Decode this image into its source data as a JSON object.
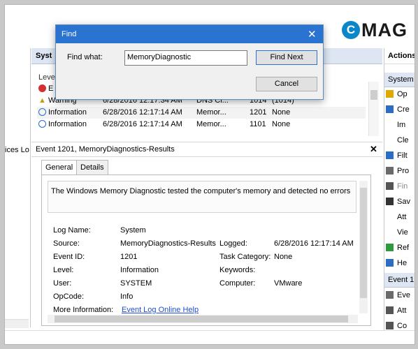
{
  "brand": {
    "letter": "C",
    "text": "MAG"
  },
  "left_pane": {
    "truncated_text": "ices Lo"
  },
  "event_list": {
    "header_title": "Syst",
    "column_header": "Leve",
    "rows": [
      {
        "level": "E",
        "date": "",
        "source": "",
        "event_id": "",
        "category": "",
        "icon": "error-icon",
        "icon_color": "#d32f2f"
      },
      {
        "level": "Warning",
        "date": "6/28/2016 12:17:34 AM",
        "source": "DNS Cl...",
        "event_id": "1014",
        "category": "(1014)",
        "icon": "warning-icon",
        "icon_color": "#f2c200"
      },
      {
        "level": "Information",
        "date": "6/28/2016 12:17:14 AM",
        "source": "Memor...",
        "event_id": "1201",
        "category": "None",
        "icon": "info-icon",
        "icon_color": "#2b6cc4"
      },
      {
        "level": "Information",
        "date": "6/28/2016 12:17:14 AM",
        "source": "Memor...",
        "event_id": "1101",
        "category": "None",
        "icon": "info-icon",
        "icon_color": "#2b6cc4"
      }
    ]
  },
  "event_detail": {
    "title": "Event 1201, MemoryDiagnostics-Results",
    "close_glyph": "✕",
    "tabs": [
      {
        "label": "General"
      },
      {
        "label": "Details"
      }
    ],
    "message": "The Windows Memory Diagnostic tested the computer's memory and detected no errors",
    "fields": {
      "log_name_label": "Log Name:",
      "log_name": "System",
      "source_label": "Source:",
      "source": "MemoryDiagnostics-Results",
      "logged_label": "Logged:",
      "logged": "6/28/2016 12:17:14 AM",
      "event_id_label": "Event ID:",
      "event_id": "1201",
      "task_category_label": "Task Category:",
      "task_category": "None",
      "level_label": "Level:",
      "level": "Information",
      "keywords_label": "Keywords:",
      "keywords": "",
      "user_label": "User:",
      "user": "SYSTEM",
      "computer_label": "Computer:",
      "computer": "VMware",
      "opcode_label": "OpCode:",
      "opcode": "Info",
      "more_info_label": "More Information:",
      "more_info_link": "Event Log Online Help"
    }
  },
  "actions_pane": {
    "title": "Actions",
    "section1": "System",
    "items1": [
      {
        "label": "Op",
        "icon": "folder-open-icon",
        "color": "#e0a800"
      },
      {
        "label": "Cre",
        "icon": "filter-icon",
        "color": "#2b6cc4"
      },
      {
        "label": "Im",
        "icon": "blank",
        "color": "#ffffff"
      },
      {
        "label": "Cle",
        "icon": "blank",
        "color": "#ffffff"
      },
      {
        "label": "Filt",
        "icon": "filter-icon",
        "color": "#2b6cc4"
      },
      {
        "label": "Pro",
        "icon": "properties-icon",
        "color": "#6a6a6a"
      },
      {
        "label": "Fin",
        "icon": "binoculars-icon",
        "color": "#555555"
      },
      {
        "label": "Sav",
        "icon": "save-icon",
        "color": "#333333"
      },
      {
        "label": "Att",
        "icon": "blank",
        "color": "#ffffff"
      },
      {
        "label": "Vie",
        "icon": "blank",
        "color": "#ffffff"
      },
      {
        "label": "Ref",
        "icon": "refresh-icon",
        "color": "#2e9a3e"
      },
      {
        "label": "He",
        "icon": "help-icon",
        "color": "#2b6cc4"
      }
    ],
    "section2": "Event 1",
    "items2": [
      {
        "label": "Eve",
        "icon": "properties-icon",
        "color": "#6a6a6a"
      },
      {
        "label": "Att",
        "icon": "task-icon",
        "color": "#555555"
      },
      {
        "label": "Co",
        "icon": "copy-icon",
        "color": "#555555"
      }
    ]
  },
  "find_dialog": {
    "title": "Find",
    "close_glyph": "✕",
    "label": "Find what:",
    "value": "MemoryDiagnostic",
    "find_next": "Find Next",
    "cancel": "Cancel"
  }
}
